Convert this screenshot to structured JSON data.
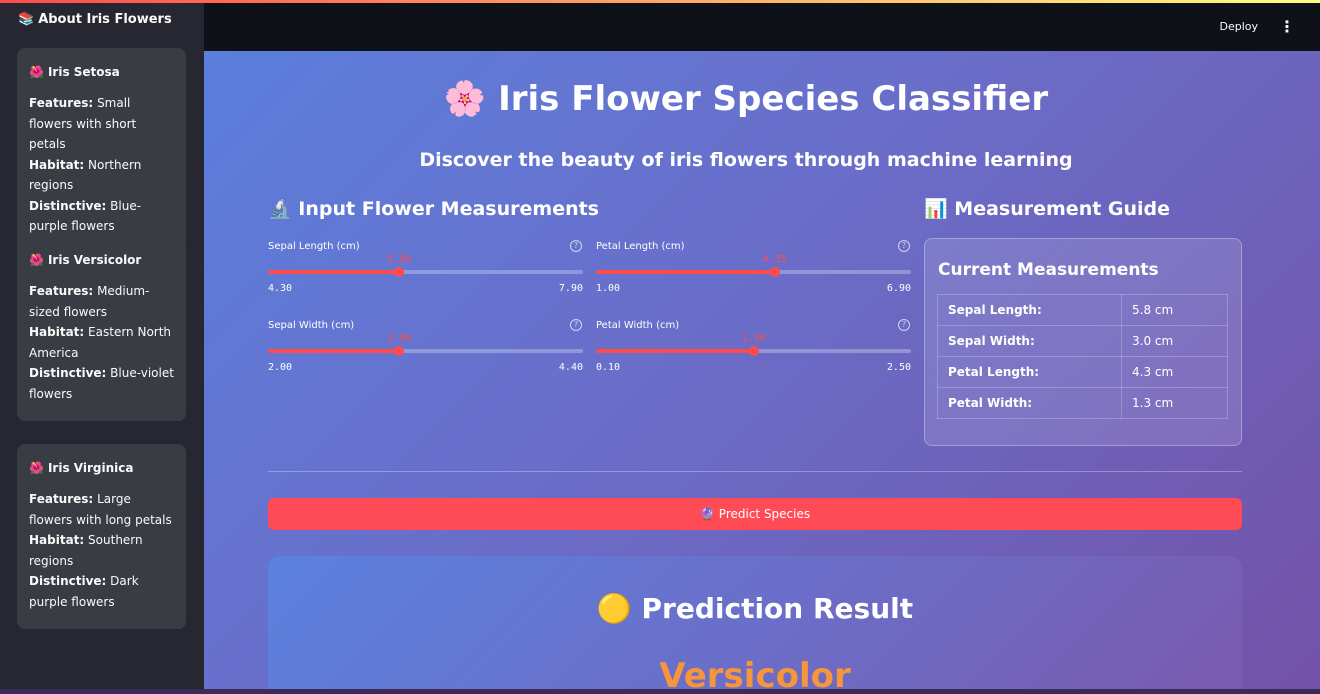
{
  "sidebar": {
    "title": "About Iris Flowers",
    "title_icon": "📚",
    "cards": [
      {
        "icon": "🌺",
        "name": "Iris Setosa",
        "features_label": "Features:",
        "features": "Small flowers with short petals",
        "habitat_label": "Habitat:",
        "habitat": "Northern regions",
        "distinctive_label": "Distinctive:",
        "distinctive": "Blue-purple flowers"
      },
      {
        "icon": "🌺",
        "name": "Iris Versicolor",
        "features_label": "Features:",
        "features": "Medium-sized flowers",
        "habitat_label": "Habitat:",
        "habitat": "Eastern North America",
        "distinctive_label": "Distinctive:",
        "distinctive": "Blue-violet flowers"
      },
      {
        "icon": "🌺",
        "name": "Iris Virginica",
        "features_label": "Features:",
        "features": "Large flowers with long petals",
        "habitat_label": "Habitat:",
        "habitat": "Southern regions",
        "distinctive_label": "Distinctive:",
        "distinctive": "Dark purple flowers"
      }
    ]
  },
  "header": {
    "deploy_label": "Deploy",
    "menu_icon": "⋮"
  },
  "main": {
    "title_icon": "🌸",
    "title": "Iris Flower Species Classifier",
    "subtitle": "Discover the beauty of iris flowers through machine learning",
    "inputs_heading_icon": "🔬",
    "inputs_heading": "Input Flower Measurements",
    "guide_heading_icon": "📊",
    "guide_heading": "Measurement Guide"
  },
  "sliders": [
    {
      "label": "Sepal Length (cm)",
      "value": "5.80",
      "min": "4.30",
      "max": "7.90"
    },
    {
      "label": "Petal Length (cm)",
      "value": "4.35",
      "min": "1.00",
      "max": "6.90"
    },
    {
      "label": "Sepal Width (cm)",
      "value": "3.00",
      "min": "2.00",
      "max": "4.40"
    },
    {
      "label": "Petal Width (cm)",
      "value": "1.30",
      "min": "0.10",
      "max": "2.50"
    }
  ],
  "help_icon": "?",
  "guide": {
    "title": "Current Measurements",
    "rows": [
      {
        "key": "Sepal Length:",
        "value": "5.8 cm"
      },
      {
        "key": "Sepal Width:",
        "value": "3.0 cm"
      },
      {
        "key": "Petal Length:",
        "value": "4.3 cm"
      },
      {
        "key": "Petal Width:",
        "value": "1.3 cm"
      }
    ]
  },
  "predict": {
    "icon": "🔮",
    "label": "Predict Species"
  },
  "result": {
    "icon": "🟡",
    "title": "Prediction Result",
    "species": "Versicolor"
  },
  "colors": {
    "accent": "#ff4b4b",
    "species": "#f7953b"
  }
}
